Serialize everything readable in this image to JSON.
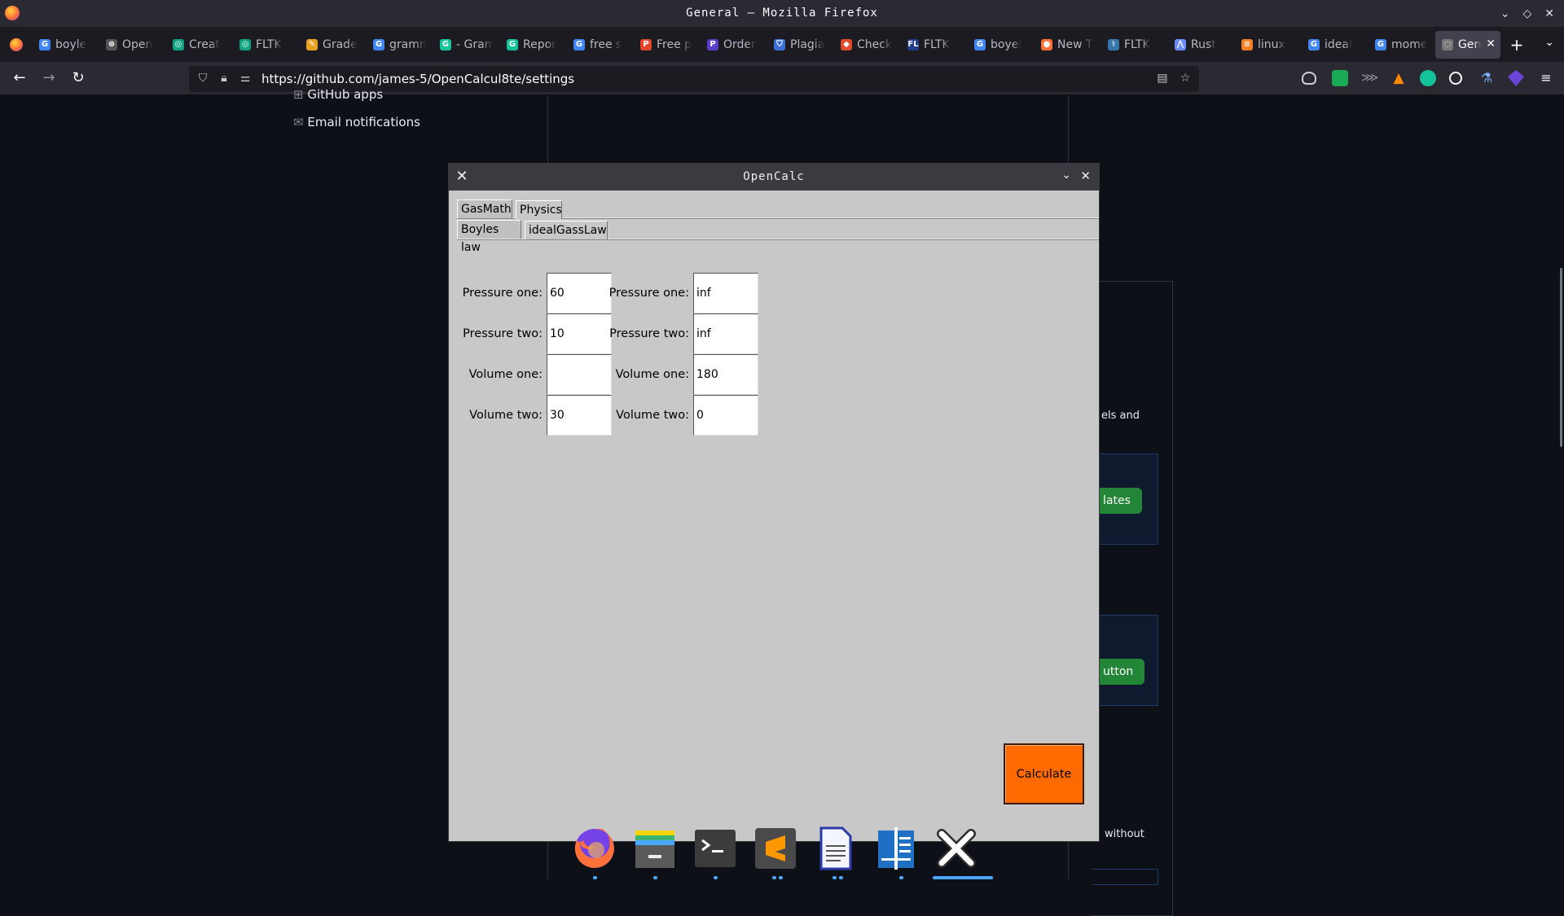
{
  "window": {
    "title": "General — Mozilla Firefox"
  },
  "tabs": [
    {
      "label": "boyle",
      "icon": "google-icon",
      "color": "#4285f4",
      "glyph": "G"
    },
    {
      "label": "Open",
      "icon": "openai-icon",
      "color": "#555555",
      "glyph": "⊛"
    },
    {
      "label": "Creat",
      "icon": "chatgpt-icon",
      "color": "#10a37f",
      "glyph": "◎"
    },
    {
      "label": "FLTK",
      "icon": "chatgpt-icon",
      "color": "#10a37f",
      "glyph": "◎"
    },
    {
      "label": "Grade",
      "icon": "pencil-icon",
      "color": "#e8a020",
      "glyph": "✎"
    },
    {
      "label": "gramm",
      "icon": "google-icon",
      "color": "#4285f4",
      "glyph": "G"
    },
    {
      "label": "- Gram",
      "icon": "grammarly-icon",
      "color": "#15c39a",
      "glyph": "G"
    },
    {
      "label": "Repor",
      "icon": "grammarly-icon",
      "color": "#15c39a",
      "glyph": "G"
    },
    {
      "label": "free s",
      "icon": "google-icon",
      "color": "#4285f4",
      "glyph": "G"
    },
    {
      "label": "Free p",
      "icon": "pdf-icon",
      "color": "#e2452a",
      "glyph": "P"
    },
    {
      "label": "Order",
      "icon": "order-icon",
      "color": "#5b3dc8",
      "glyph": "P"
    },
    {
      "label": "Plagia",
      "icon": "shield-icon",
      "color": "#3b6fd8",
      "glyph": "⛉"
    },
    {
      "label": "Check",
      "icon": "check-icon",
      "color": "#e04a2a",
      "glyph": "◆"
    },
    {
      "label": "FLTK",
      "icon": "fltk-icon",
      "color": "#1f3b8a",
      "glyph": "FL"
    },
    {
      "label": "boyel",
      "icon": "google-icon",
      "color": "#4285f4",
      "glyph": "G"
    },
    {
      "label": "New T",
      "icon": "firefox-icon",
      "color": "#ff7139",
      "glyph": "●"
    },
    {
      "label": "FLTK",
      "icon": "python-icon",
      "color": "#3776ab",
      "glyph": "⚕"
    },
    {
      "label": "Rust",
      "icon": "rust-icon",
      "color": "#6a8cff",
      "glyph": "⋀"
    },
    {
      "label": "linux",
      "icon": "stackoverflow-icon",
      "color": "#f48024",
      "glyph": "≡"
    },
    {
      "label": "ideal",
      "icon": "google-icon",
      "color": "#4285f4",
      "glyph": "G"
    },
    {
      "label": "mome",
      "icon": "google-icon",
      "color": "#4285f4",
      "glyph": "G"
    },
    {
      "label": "Gen",
      "icon": "loading-icon",
      "color": "#777777",
      "glyph": "◌",
      "active": true
    }
  ],
  "nav": {
    "url": "https://github.com/james-5/OpenCalcul8te/settings"
  },
  "github": {
    "sidebar": [
      "GitHub apps",
      "Email notifications"
    ],
    "fragments": {
      "models": "els and",
      "templates": "lates",
      "button": "utton",
      "without": "without"
    }
  },
  "opencalc": {
    "title": "OpenCalc",
    "top_tabs": [
      "GasMath",
      "Physics"
    ],
    "sub_tabs": [
      "Boyles law",
      "idealGassLaw"
    ],
    "left": {
      "labels": [
        "Pressure one:",
        "Pressure two:",
        "Volume one:",
        "Volume two:"
      ],
      "values": [
        "60",
        "10",
        "",
        "30"
      ]
    },
    "right": {
      "labels": [
        "Pressure one:",
        "Pressure two:",
        "Volume one:",
        "Volume two:"
      ],
      "values": [
        "inf",
        "inf",
        "180",
        "0"
      ]
    },
    "calculate_label": "Calculate",
    "accent": "#ff6a00"
  },
  "dock": [
    "firefox-icon",
    "files-icon",
    "terminal-icon",
    "sublime-text-icon",
    "text-editor-icon",
    "writer-icon",
    "x-icon"
  ]
}
